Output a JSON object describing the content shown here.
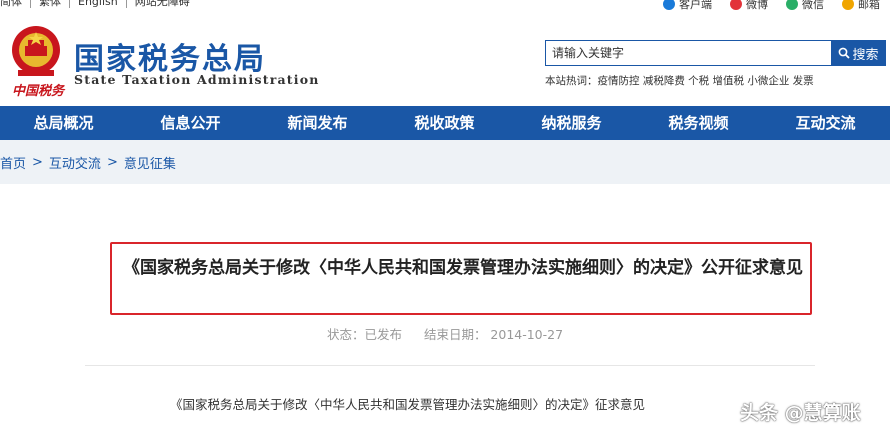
{
  "topbar": {
    "links": [
      "简体",
      "繁体",
      "English",
      "网站无障碍"
    ],
    "right": [
      {
        "label": "客户端",
        "icon": "app-icon",
        "color": "#1a7ad9"
      },
      {
        "label": "微博",
        "icon": "weibo-icon",
        "color": "#e2333a"
      },
      {
        "label": "微信",
        "icon": "wechat-icon",
        "color": "#2aae67"
      },
      {
        "label": "邮箱",
        "icon": "mail-icon",
        "color": "#f0a500"
      }
    ]
  },
  "header": {
    "cn_mark": "中国税务",
    "title": "国家税务总局",
    "subtitle": "State Taxation Administration",
    "search_placeholder": "请输入关键字",
    "search_button": "搜索",
    "hot_label": "本站热词：",
    "hot_words": "疫情防控 减税降费 个税 增值税 小微企业 发票"
  },
  "nav": {
    "items": [
      "总局概况",
      "信息公开",
      "新闻发布",
      "税收政策",
      "纳税服务",
      "税务视频",
      "互动交流"
    ]
  },
  "breadcrumb": {
    "items": [
      "首页",
      "互动交流",
      "意见征集"
    ],
    "separator": ">"
  },
  "article": {
    "title": "《国家税务总局关于修改〈中华人民共和国发票管理办法实施细则〉的决定》公开征求意见",
    "status": "状态：已发布",
    "end_date": "结束日期： 2014-10-27",
    "body_first_line": "《国家税务总局关于修改〈中华人民共和国发票管理办法实施细则〉的决定》征求意见"
  },
  "watermark": "头条 @慧算账",
  "colors": {
    "brand_blue": "#1a57a6",
    "highlight_red": "#d9252b",
    "crumb_bg": "#eef2f6"
  }
}
